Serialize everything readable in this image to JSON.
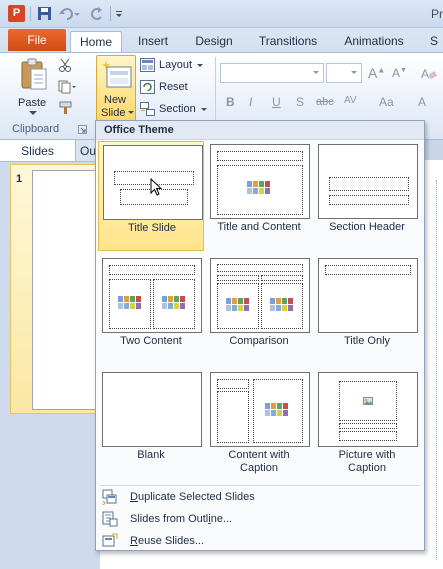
{
  "titlebar": {
    "title_fragment": "Pr",
    "app_icon_letter": "P"
  },
  "tabs": {
    "file": "File",
    "items": [
      "Home",
      "Insert",
      "Design",
      "Transitions",
      "Animations",
      "S"
    ],
    "active": "Home"
  },
  "ribbon": {
    "paste_label": "Paste",
    "new_slide_line1": "New",
    "new_slide_line2": "Slide",
    "layout_label": "Layout",
    "reset_label": "Reset",
    "section_label": "Section",
    "clipboard_group": "Clipboard",
    "format_glyphs": [
      "B",
      "I",
      "U",
      "S",
      "abc",
      "AV",
      "Aa",
      "A"
    ]
  },
  "left_pane": {
    "tab_slides": "Slides",
    "tab_outline": "Ou",
    "slide_number": "1"
  },
  "dropdown": {
    "header": "Office Theme",
    "layouts": [
      {
        "name": "Title Slide",
        "selected": true
      },
      {
        "name": "Title and Content",
        "selected": false
      },
      {
        "name": "Section Header",
        "selected": false
      },
      {
        "name": "Two Content",
        "selected": false
      },
      {
        "name": "Comparison",
        "selected": false
      },
      {
        "name": "Title Only",
        "selected": false
      },
      {
        "name": "Blank",
        "selected": false
      },
      {
        "name_line1": "Content with",
        "name_line2": "Caption",
        "selected": false
      },
      {
        "name_line1": "Picture with",
        "name_line2": "Caption",
        "selected": false
      }
    ],
    "menu": [
      {
        "prefix": "",
        "key": "D",
        "rest": "uplicate Selected Slides"
      },
      {
        "prefix": "Slides from Outl",
        "key": "i",
        "rest": "ne..."
      },
      {
        "prefix": "",
        "key": "R",
        "rest": "euse Slides..."
      }
    ]
  },
  "colors": {
    "file_tab": "#d24a14",
    "selection": "#ffe48a",
    "ribbon_bg": "#e7eef8"
  }
}
